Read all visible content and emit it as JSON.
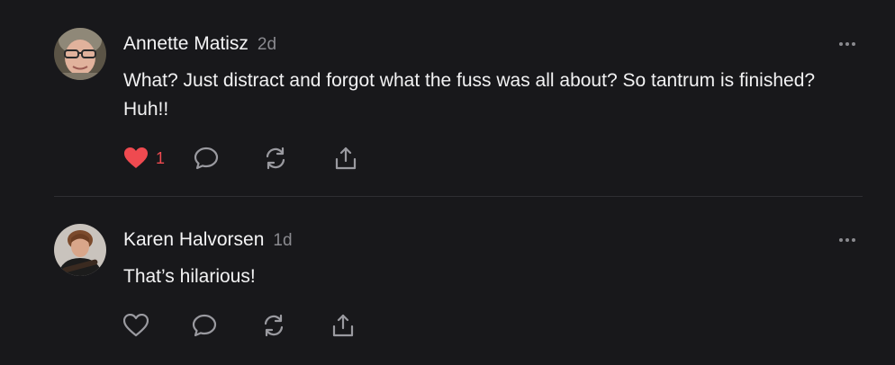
{
  "comments": [
    {
      "author": "Annette Matisz",
      "time": "2d",
      "text": "What? Just distract and forgot what the fuss was all about? So tantrum is finished? Huh!!",
      "liked": true,
      "like_count": "1",
      "like_icon": "heart-filled-icon"
    },
    {
      "author": "Karen Halvorsen",
      "time": "1d",
      "text": "That’s hilarious!",
      "liked": false,
      "like_count": "",
      "like_icon": "heart-outline-icon"
    }
  ],
  "icons": {
    "more": "ellipsis-icon",
    "reply": "speech-bubble-icon",
    "restack": "refresh-icon",
    "share": "share-upload-icon"
  },
  "colors": {
    "background": "#18181b",
    "text": "#f2f2f3",
    "muted": "#8a8a8f",
    "like": "#ef4a50",
    "icon": "#9a9aa0",
    "divider": "#2e2e33"
  }
}
